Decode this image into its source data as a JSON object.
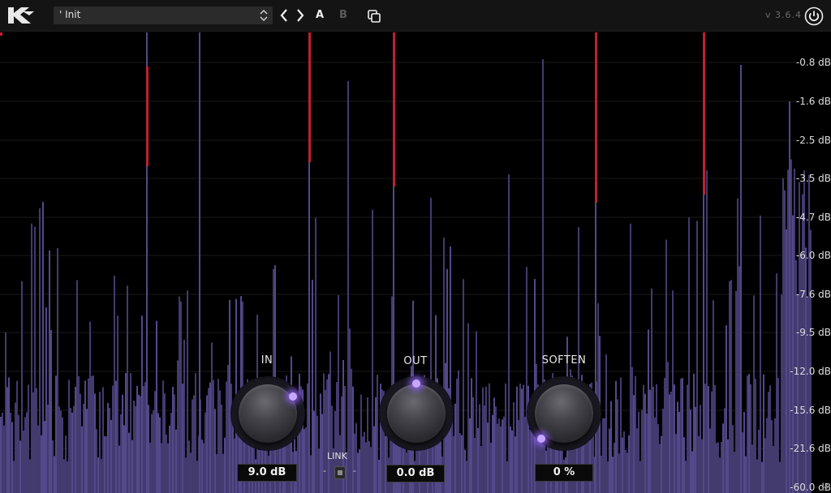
{
  "header": {
    "preset_name": "' Init",
    "a_label": "A",
    "b_label": "B",
    "version": "v 3.6.4"
  },
  "scale": {
    "labels": [
      "-0.8 dB",
      "-1.6 dB",
      "-2.5 dB",
      "-3.5 dB",
      "-4.7 dB",
      "-6.0 dB",
      "-7.6 dB",
      "-9.5 dB",
      "-12.0 dB",
      "-15.6 dB",
      "-21.6 dB",
      "-60.0 dB"
    ]
  },
  "controls": {
    "in": {
      "label": "IN",
      "value": "9.0 dB"
    },
    "out": {
      "label": "OUT",
      "value": "0.0 dB"
    },
    "soften": {
      "label": "SOFTEN",
      "value": "0 %"
    },
    "link": {
      "label": "LINK",
      "left_dash": "-",
      "right_dash": "-"
    }
  },
  "colors": {
    "bars": "#433a6e",
    "bars_tip": "#534889",
    "peak": "#c0202e",
    "accent": "#9a6dff"
  }
}
